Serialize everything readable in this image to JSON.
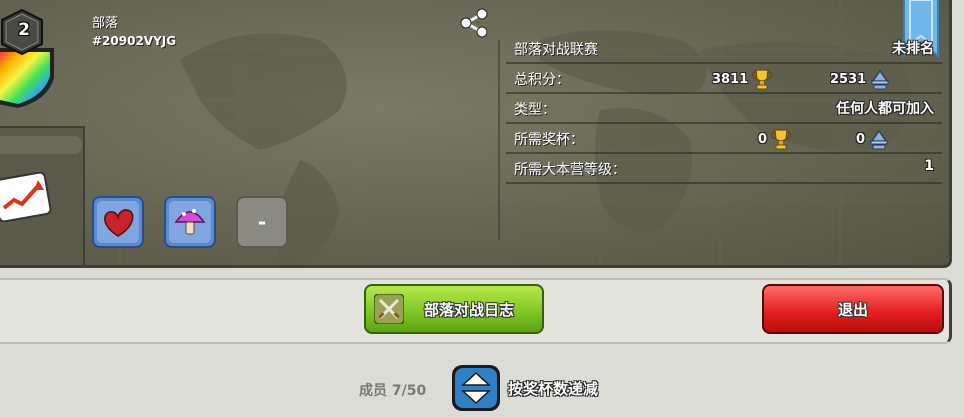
{
  "clan": {
    "level": "2",
    "name": "部落",
    "tag": "#20902VYJG"
  },
  "war_league": {
    "label": "部落对战联赛",
    "value": "未排名"
  },
  "stats": {
    "total_points_label": "总积分：",
    "trophies": "3811",
    "builder_trophies": "2531",
    "type_label": "类型：",
    "type_value": "任何人都可加入",
    "required_trophies_label": "所需奖杯：",
    "required_trophies": "0",
    "required_builder_trophies": "0",
    "required_th_label": "所需大本营等级：",
    "required_th_value": "1"
  },
  "perks": {
    "third_label": "-"
  },
  "buttons": {
    "war_log": "部落对战日志",
    "exit": "退出"
  },
  "members": {
    "label": "成员 7/50",
    "sort_label": "按奖杯数递减"
  },
  "colors": {
    "panel": "#666553",
    "war_log_button": "#7cc422",
    "exit_button": "#e21c1c",
    "sort_button": "#2f7fc8"
  },
  "icons": [
    "share-icon",
    "trophy-icon",
    "builder-trophy-icon",
    "crossed-swords-icon",
    "sort-arrows-icon",
    "heart-icon",
    "mushroom-icon",
    "trend-chart-icon"
  ]
}
